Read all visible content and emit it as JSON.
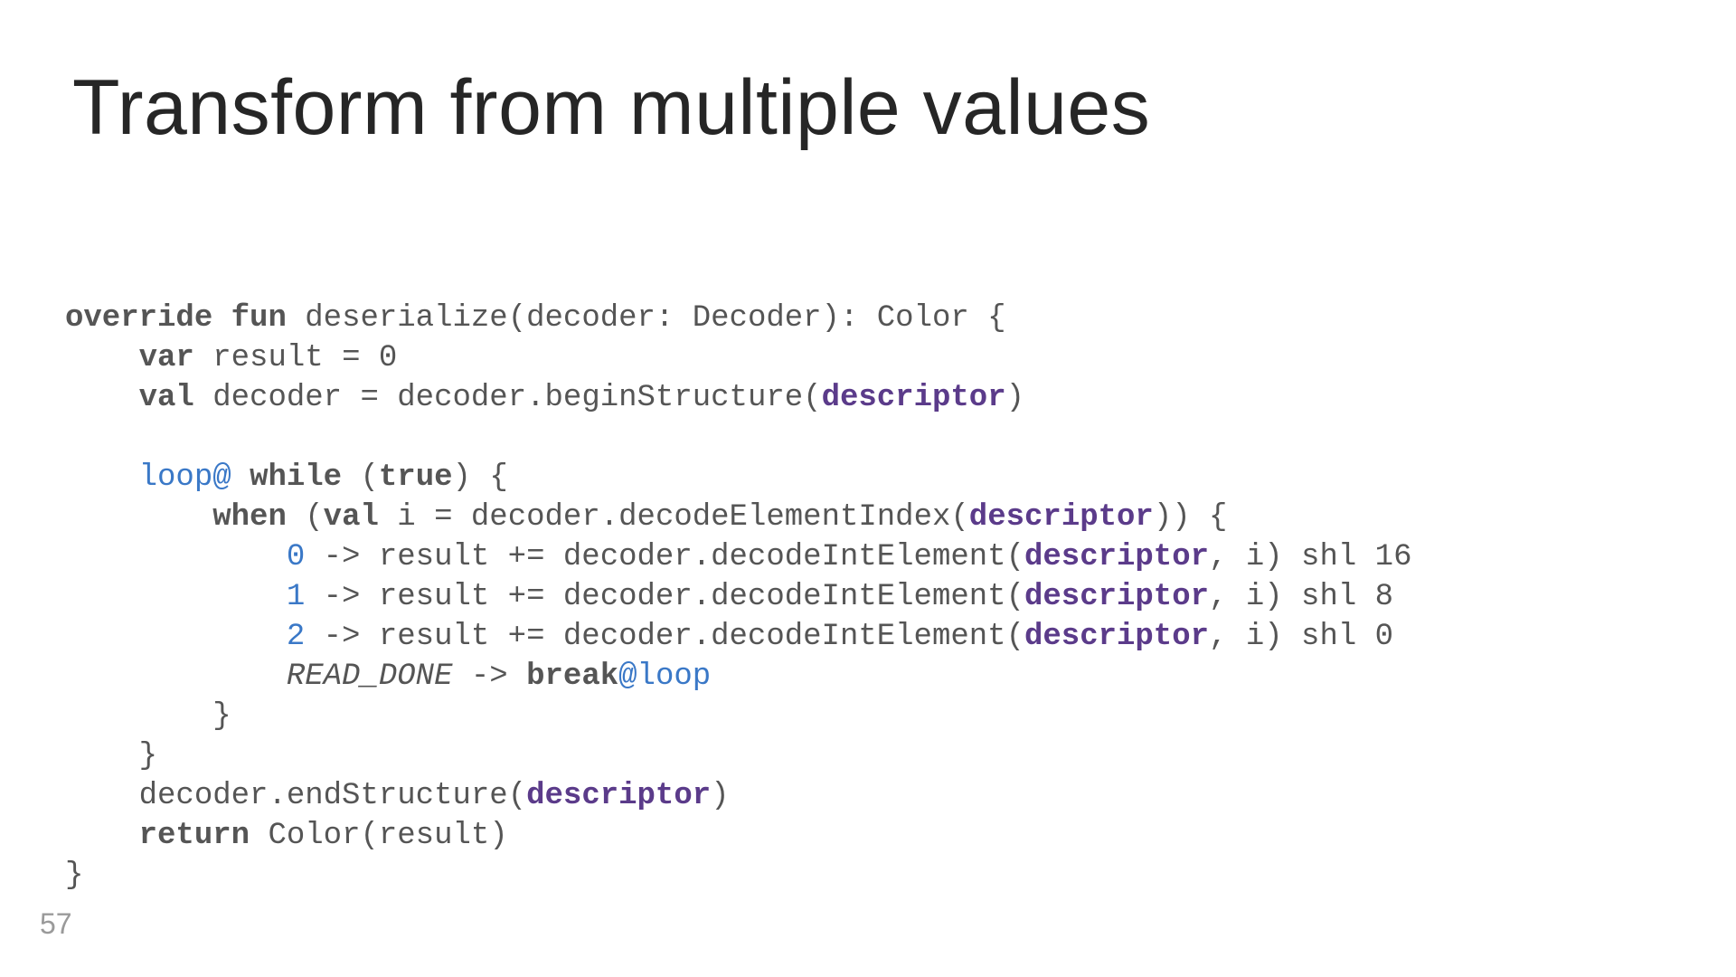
{
  "slide": {
    "title": "Transform from multiple values",
    "page_number": "57"
  },
  "code": {
    "l1_override": "override",
    "l1_fun": "fun",
    "l1_rest": " deserialize(decoder: Decoder): Color {",
    "l2_indent": "    ",
    "l2_var": "var",
    "l2_rest": " result = 0",
    "l3_indent": "    ",
    "l3_val": "val",
    "l3_rest1": " decoder = decoder.beginStructure(",
    "l3_desc": "descriptor",
    "l3_rest2": ")",
    "l5_indent": "    ",
    "l5_label": "loop@",
    "l5_sp": " ",
    "l5_while": "while",
    "l5_sp2": " (",
    "l5_true": "true",
    "l5_rest": ") {",
    "l6_indent": "        ",
    "l6_when": "when",
    "l6_sp": " (",
    "l6_val": "val",
    "l6_rest1": " i = decoder.decodeElementIndex(",
    "l6_desc": "descriptor",
    "l6_rest2": ")) {",
    "l7_indent": "            ",
    "l7_num": "0",
    "l7_rest1": " -> result += decoder.decodeIntElement(",
    "l7_desc": "descriptor",
    "l7_rest2": ", i) shl 16",
    "l8_indent": "            ",
    "l8_num": "1",
    "l8_rest1": " -> result += decoder.decodeIntElement(",
    "l8_desc": "descriptor",
    "l8_rest2": ", i) shl 8",
    "l9_indent": "            ",
    "l9_num": "2",
    "l9_rest1": " -> result += decoder.decodeIntElement(",
    "l9_desc": "descriptor",
    "l9_rest2": ", i) shl 0",
    "l10_indent": "            ",
    "l10_readdone": "READ_DONE",
    "l10_arrow": " -> ",
    "l10_break": "break",
    "l10_label": "@loop",
    "l11_indent": "        ",
    "l11_brace": "}",
    "l12_indent": "    ",
    "l12_brace": "}",
    "l13_indent": "    ",
    "l13_rest1": "decoder.endStructure(",
    "l13_desc": "descriptor",
    "l13_rest2": ")",
    "l14_indent": "    ",
    "l14_return": "return",
    "l14_rest": " Color(result)",
    "l15_brace": "}"
  }
}
